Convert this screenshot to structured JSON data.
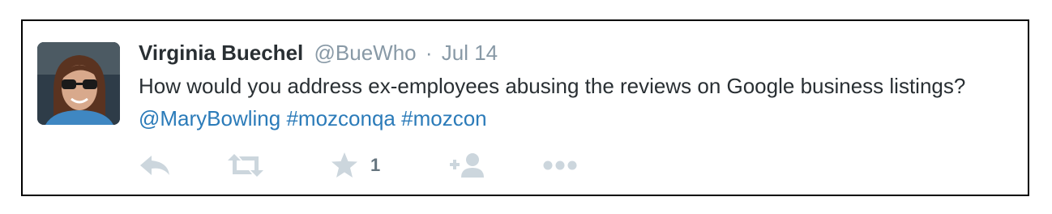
{
  "tweet": {
    "display_name": "Virginia Buechel",
    "handle": "@BueWho",
    "separator": "·",
    "timestamp": "Jul 14",
    "text_plain": "How would you address ex-employees abusing the reviews on Google business listings?",
    "mention": "@MaryBowling",
    "hashtags": [
      "#mozconqa",
      "#mozcon"
    ]
  },
  "actions": {
    "reply_icon": "reply-icon",
    "retweet_icon": "retweet-icon",
    "favorite_icon": "star-icon",
    "favorite_count": "1",
    "follow_icon": "follow-icon",
    "more_icon": "more-icon"
  },
  "colors": {
    "name": "#292f33",
    "muted": "#8899a6",
    "link": "#2b7bb9",
    "icon": "#ccd6dd",
    "border": "#000000"
  }
}
